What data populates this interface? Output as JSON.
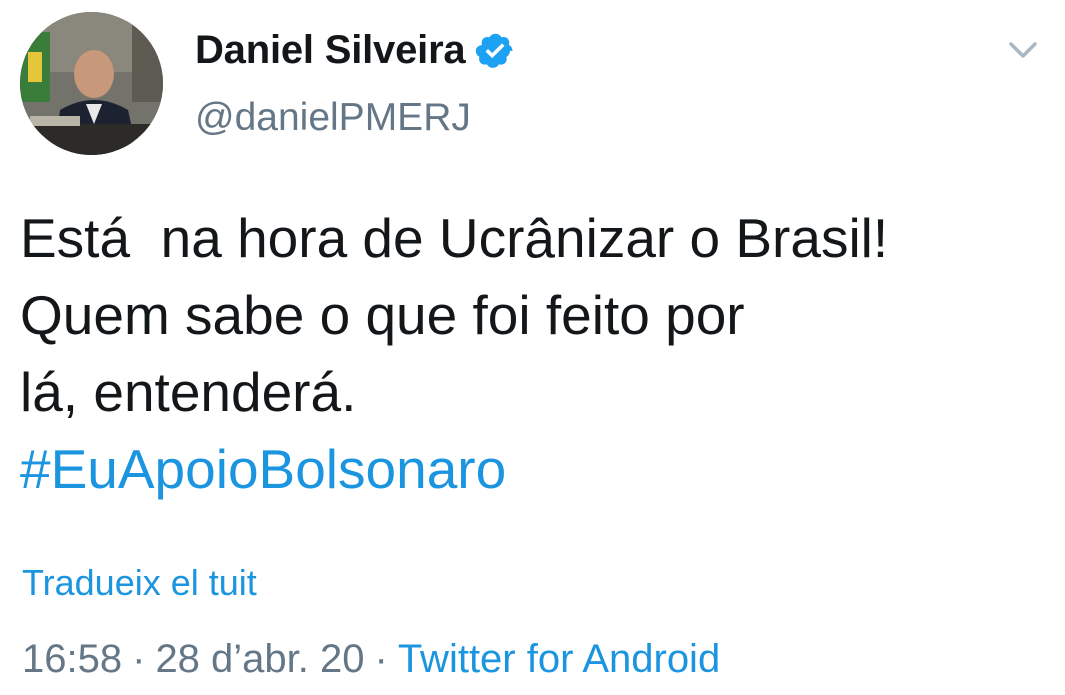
{
  "author": {
    "display_name": "Daniel Silveira",
    "handle": "@danielPMERJ",
    "verified": true
  },
  "tweet": {
    "text": "Está  na hora de Ucrânizar o Brasil!\nQuem sabe o que foi feito por\nlá, entenderá.",
    "hashtag": "#EuApoioBolsonaro",
    "translate_label": "Tradueix el tuit",
    "time": "16:58",
    "date": "28 d’abr. 20",
    "separator": "·",
    "source": "Twitter for Android"
  },
  "icons": {
    "verified": "verified-badge-icon",
    "caret": "chevron-down-icon"
  },
  "colors": {
    "link": "#1b95e0",
    "secondary_text": "#657786",
    "primary_text": "#14171a",
    "verified": "#1da1f2"
  }
}
